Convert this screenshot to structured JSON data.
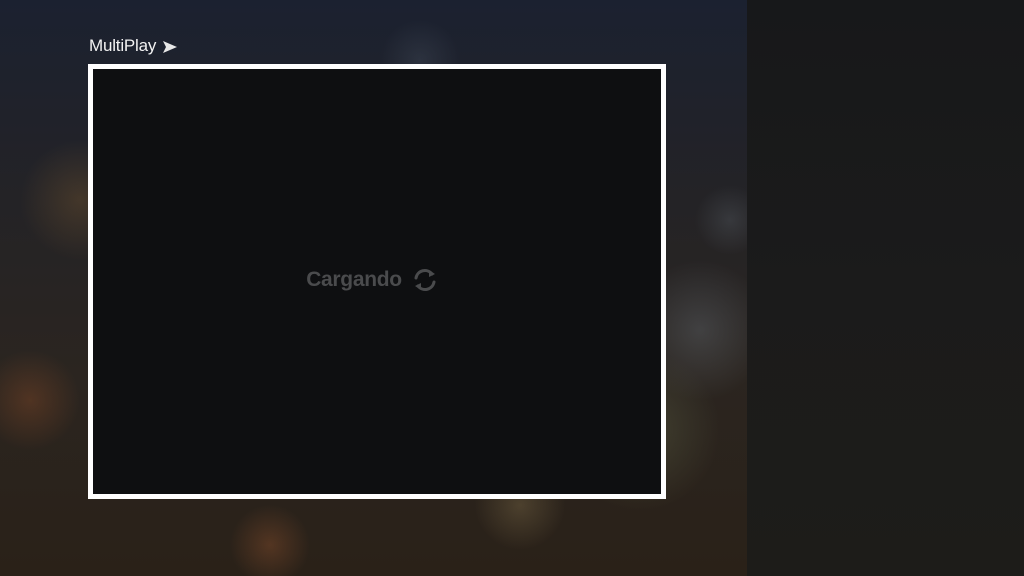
{
  "header": {
    "title": "MultiPlay",
    "title_icon": "send-arrow-icon"
  },
  "player": {
    "loading_text": "Cargando",
    "loading_icon": "refresh-icon",
    "frame_color": "#ffffff",
    "screen_color": "#0e0f11"
  }
}
